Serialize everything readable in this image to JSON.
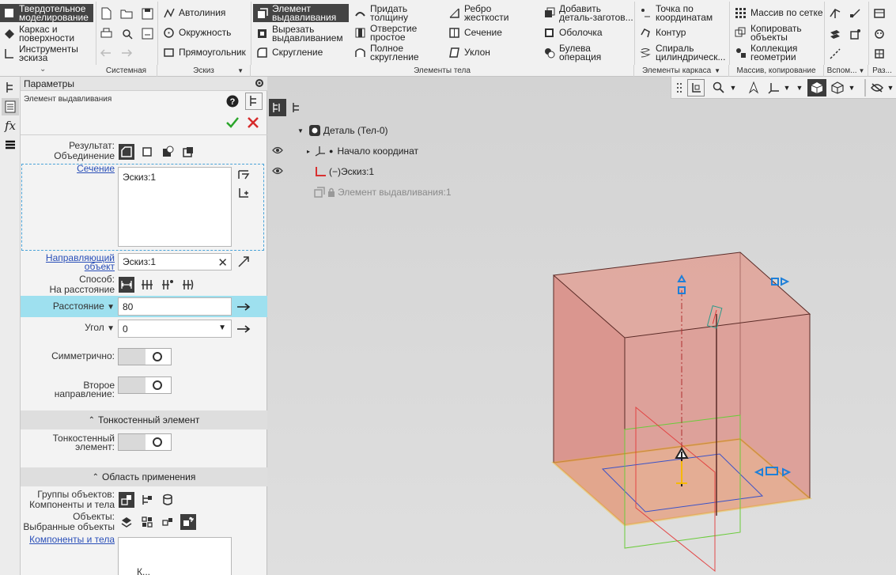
{
  "ribbon": {
    "mode_tabs": [
      "Твердотельное моделирование",
      "Каркас и поверхности",
      "Инструменты эскиза"
    ],
    "system_group": "Системная",
    "sketch": {
      "autoline": "Автолиния",
      "circle": "Окружность",
      "rectangle": "Прямоугольник",
      "group": "Эскиз"
    },
    "body": {
      "extrude": "Элемент выдавливания",
      "cut_extrude": "Вырезать выдавливанием",
      "fillet": "Скругление",
      "thicken": "Придать толщину",
      "simple_hole": "Отверстие простое",
      "full_fillet": "Полное скругление",
      "rib": "Ребро жесткости",
      "section": "Сечение",
      "draft": "Уклон",
      "add_blank": "Добавить деталь-заготов...",
      "shell": "Оболочка",
      "boolean": "Булева операция",
      "group": "Элементы тела"
    },
    "frame": {
      "point": "Точка по координатам",
      "contour": "Контур",
      "spiral": "Спираль цилиндрическ...",
      "group": "Элементы каркаса"
    },
    "array": {
      "grid": "Массив по сетке",
      "copy": "Копировать объекты",
      "collection": "Коллекция геометрии",
      "group": "Массив, копирование"
    },
    "aux_group": "Вспом...",
    "misc_group": "Раз..."
  },
  "panel": {
    "title": "Параметры",
    "element_name": "Элемент выдавливания",
    "result_label": "Результат:",
    "result_value": "Объединение",
    "section_link": "Сечение",
    "section_list_item": "Эскиз:1",
    "guide_link": "Направляющий объект",
    "guide_value": "Эскиз:1",
    "method_label": "Способ:",
    "method_value": "На расстояние",
    "distance_label": "Расстояние",
    "distance_value": "80",
    "angle_label": "Угол",
    "angle_value": "0",
    "symmetric_label": "Симметрично:",
    "second_dir_label": "Второе направление:",
    "thin_header": "Тонкостенный элемент",
    "thin_label": "Тонкостенный элемент:",
    "scope_header": "Область применения",
    "groups_label": "Группы объектов:",
    "groups_value": "Компоненты и тела",
    "objects_label": "Объекты:",
    "objects_value": "Выбранные объекты",
    "components_link": "Компоненты и тела",
    "components_list_partial": "К..."
  },
  "tree": {
    "root": "Деталь (Тел-0)",
    "origin": "Начало координат",
    "sketch": "Эскиз:1",
    "extrude": "Элемент выдавливания:1"
  },
  "colors": {
    "accent_highlight": "#9ee0ef",
    "body_fill": "#d98c84",
    "selection": "#f6b800",
    "gizmo": "#1e7fd8"
  }
}
